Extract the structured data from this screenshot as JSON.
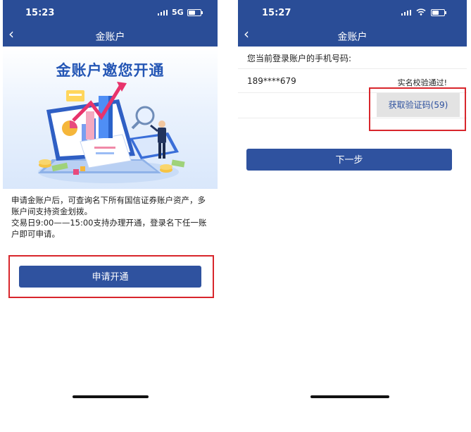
{
  "phone1": {
    "status": {
      "time": "15:23",
      "network": "5G"
    },
    "nav": {
      "back": "‹",
      "title": "金账户"
    },
    "banner": {
      "title": "金账户邀您开通"
    },
    "description": {
      "line1": "申请金账户后，可查询名下所有国信证券账户资产，多账户间支持资金划拨。",
      "line2": "交易日9:00——15:00支持办理开通，登录名下任一账户即可申请。"
    },
    "apply_button": "申请开通"
  },
  "phone2": {
    "status": {
      "time": "15:27"
    },
    "nav": {
      "back": "‹",
      "title": "金账户"
    },
    "phone_label": "您当前登录账户的手机号码:",
    "phone_number": "189****679",
    "verify_status": "实名校验通过!",
    "get_code_button": "获取验证码(59)",
    "next_button": "下一步"
  },
  "colors": {
    "brand_blue": "#2a4d97",
    "button_blue": "#2f529f",
    "highlight_red": "#d8262c"
  }
}
